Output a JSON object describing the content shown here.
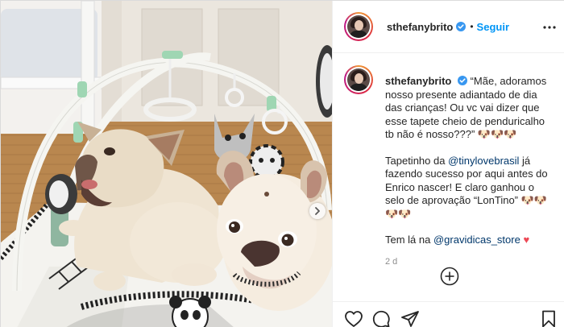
{
  "post": {
    "header": {
      "username": "sthefanybrito",
      "separator": "•",
      "follow_label": "Seguir"
    },
    "caption": {
      "username": "sthefanybrito",
      "paragraph1": "“Mãe, adoramos nosso presente adiantado de dia das crianças! Ou vc vai dizer que esse tapete cheio de penduricalho tb não é nosso???” 🐶🐶🐶",
      "p2_before": "Tapetinho da ",
      "p2_mention": "@tinylovebrasil",
      "p2_after": " já fazendo sucesso por aqui antes do Enrico nascer! E claro ganhou o selo de aprovação “LonTino” 🐶🐶🐶🐶",
      "p3_before": "Tem lá na ",
      "p3_mention": "@gravidicas_store",
      "p3_after": " ",
      "heart": "♥"
    },
    "time_ago": "2 d",
    "icons": {
      "verified": "verified-badge-icon",
      "more": "more-options-icon",
      "next": "chevron-right-icon",
      "load_more": "plus-circle-icon",
      "like": "heart-icon",
      "comment": "comment-icon",
      "share": "paper-plane-icon",
      "save": "bookmark-icon"
    },
    "colors": {
      "link_blue": "#0095f6",
      "mention": "#00376b",
      "verified_blue": "#3897f0",
      "heart_red": "#ed4956",
      "meta_gray": "#8e8e8e"
    }
  }
}
